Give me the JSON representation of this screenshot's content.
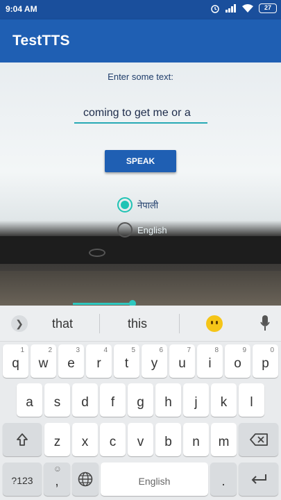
{
  "status_bar": {
    "time": "9:04 AM",
    "battery": "27"
  },
  "app": {
    "title": "TestTTS"
  },
  "form": {
    "prompt": "Enter some text:",
    "input_value": "coming to get me or a",
    "speak_label": "SPEAK",
    "radios": [
      {
        "label": "नेपाली",
        "checked": true
      },
      {
        "label": "English",
        "checked": false
      }
    ]
  },
  "keyboard": {
    "suggestions": [
      "that",
      "this"
    ],
    "row1": [
      {
        "k": "q",
        "n": "1"
      },
      {
        "k": "w",
        "n": "2"
      },
      {
        "k": "e",
        "n": "3"
      },
      {
        "k": "r",
        "n": "4"
      },
      {
        "k": "t",
        "n": "5"
      },
      {
        "k": "y",
        "n": "6"
      },
      {
        "k": "u",
        "n": "7"
      },
      {
        "k": "i",
        "n": "8"
      },
      {
        "k": "o",
        "n": "9"
      },
      {
        "k": "p",
        "n": "0"
      }
    ],
    "row2": [
      "a",
      "s",
      "d",
      "f",
      "g",
      "h",
      "j",
      "k",
      "l"
    ],
    "row3": [
      "z",
      "x",
      "c",
      "v",
      "b",
      "n",
      "m"
    ],
    "symbols_label": "?123",
    "comma_label": ",",
    "space_label": "English",
    "period_label": "."
  },
  "colors": {
    "primary": "#1f5fb3",
    "status_bar": "#1a4f9c",
    "accent": "#1fc3b4"
  }
}
